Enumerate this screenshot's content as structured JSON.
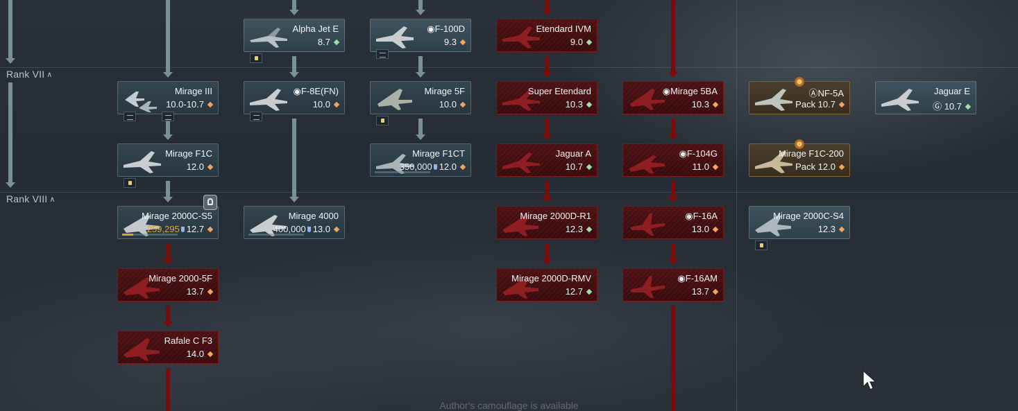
{
  "ranks": [
    {
      "label": "Rank VII"
    },
    {
      "label": "Rank VIII"
    }
  ],
  "footer_note": "Author's camouflage is available",
  "cards": [
    {
      "id": "alpha-jet-e",
      "name": "Alpha Jet E",
      "br": "8.7",
      "mode": "gr"
    },
    {
      "id": "f-100d",
      "name": "◉F-100D",
      "br": "9.3",
      "mode": "o"
    },
    {
      "id": "etendard-ivm",
      "name": "Etendard IVM",
      "br": "9.0",
      "mode": "gr"
    },
    {
      "id": "mirage-iii",
      "name": "Mirage III",
      "br": "10.0-10.7",
      "mode": "o"
    },
    {
      "id": "f-8e-fn",
      "name": "◉F-8E(FN)",
      "br": "10.0",
      "mode": "o"
    },
    {
      "id": "mirage-5f",
      "name": "Mirage 5F",
      "br": "10.0",
      "mode": "o"
    },
    {
      "id": "super-etendard",
      "name": "Super Etendard",
      "br": "10.3",
      "mode": "gr"
    },
    {
      "id": "mirage-5ba",
      "name": "◉Mirage 5BA",
      "br": "10.3",
      "mode": "o"
    },
    {
      "id": "nf-5a",
      "name": "ⒶNF-5A",
      "br": "Pack 10.7",
      "mode": "o"
    },
    {
      "id": "jaguar-e",
      "name": "Jaguar E",
      "br": "Ⓖ 10.7",
      "mode": "gr"
    },
    {
      "id": "mirage-f1c",
      "name": "Mirage F1C",
      "br": "12.0",
      "mode": "o"
    },
    {
      "id": "mirage-f1ct",
      "name": "Mirage F1CT",
      "cost": "350,000",
      "br": "12.0",
      "mode": "o"
    },
    {
      "id": "jaguar-a",
      "name": "Jaguar A",
      "br": "10.7",
      "mode": "gr"
    },
    {
      "id": "f-104g",
      "name": "◉F-104G",
      "br": "11.0",
      "mode": "o"
    },
    {
      "id": "mirage-f1c-200",
      "name": "Mirage F1C-200",
      "br": "Pack 12.0",
      "mode": "o"
    },
    {
      "id": "mirage-2000c-s5",
      "name": "Mirage 2000C-S5",
      "cost": "259,295",
      "br": "12.7",
      "mode": "o",
      "progress": 0.2
    },
    {
      "id": "mirage-4000",
      "name": "Mirage 4000",
      "cost": "400,000",
      "br": "13.0",
      "mode": "o",
      "progress": 0
    },
    {
      "id": "mirage-2000d-r1",
      "name": "Mirage 2000D-R1",
      "br": "12.3",
      "mode": "gr"
    },
    {
      "id": "f-16a",
      "name": "◉F-16A",
      "br": "13.0",
      "mode": "o"
    },
    {
      "id": "mirage-2000c-s4",
      "name": "Mirage 2000C-S4",
      "br": "12.3",
      "mode": "o"
    },
    {
      "id": "mirage-2000-5f",
      "name": "Mirage 2000-5F",
      "br": "13.7",
      "mode": "o"
    },
    {
      "id": "mirage-2000d-rmv",
      "name": "Mirage 2000D-RMV",
      "br": "12.7",
      "mode": "gr"
    },
    {
      "id": "f-16am",
      "name": "◉F-16AM",
      "br": "13.7",
      "mode": "o"
    },
    {
      "id": "rafale-c-f3",
      "name": "Rafale C F3",
      "br": "14.0",
      "mode": "o"
    }
  ],
  "colors": {
    "silver_br_icon": "#f0a560",
    "green_br_icon": "#9fe0a8",
    "locked": "#7a0c0c",
    "line": "#7a9194",
    "premium_border": "#c8a05a"
  }
}
